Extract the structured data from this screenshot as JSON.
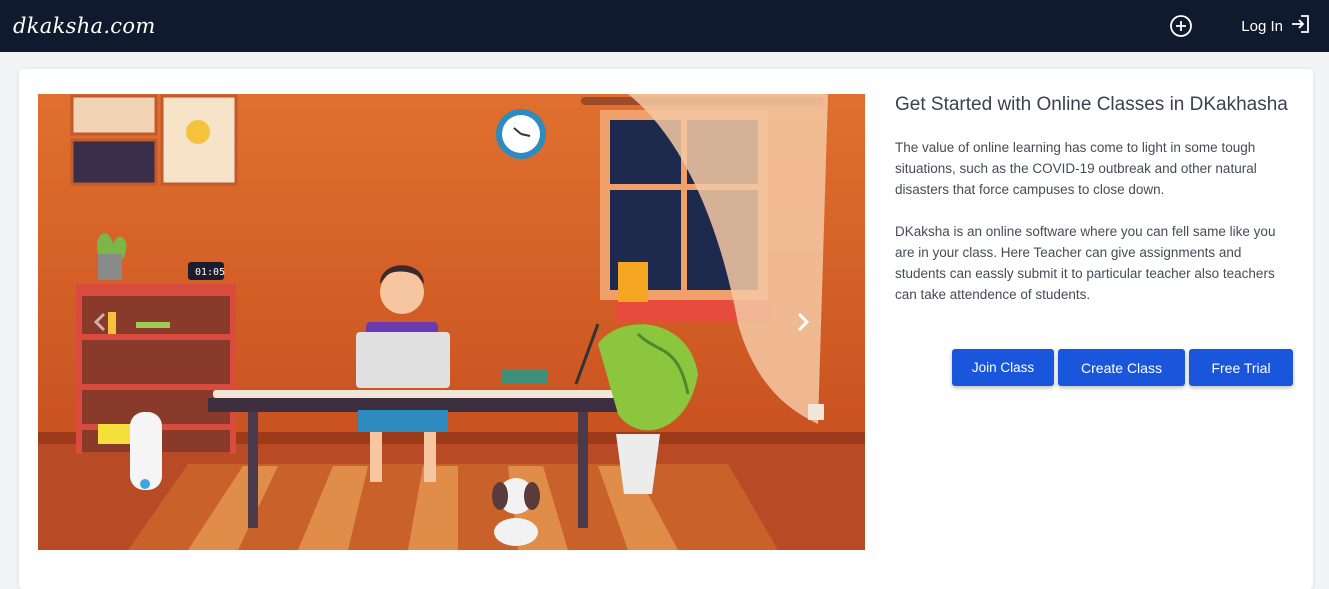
{
  "nav": {
    "brand": "dkaksha.com",
    "login_label": "Log In",
    "icons": [
      "plus-circle-icon",
      "login-arrow-icon"
    ]
  },
  "hero": {
    "clock_text": "01:05",
    "prev_icon": "chevron-left-icon",
    "next_icon": "chevron-right-icon"
  },
  "content": {
    "title": "Get Started with Online Classes in DKakhasha",
    "paragraph1": "The value of online learning has come to light in some tough situations, such as the COVID-19 outbreak and other natural disasters that force campuses to close down.",
    "paragraph2": "DKaksha is an online software where you can fell same like you are in your class. Here Teacher can give assignments and students can eassly submit it to particular teacher also teachers can take attendence of students."
  },
  "actions": {
    "join": "Join Class",
    "create": "Create Class",
    "trial": "Free Trial"
  },
  "colors": {
    "navbar": "#0f1a2e",
    "primary_button": "#1a56db",
    "wall": "#d9652c"
  }
}
